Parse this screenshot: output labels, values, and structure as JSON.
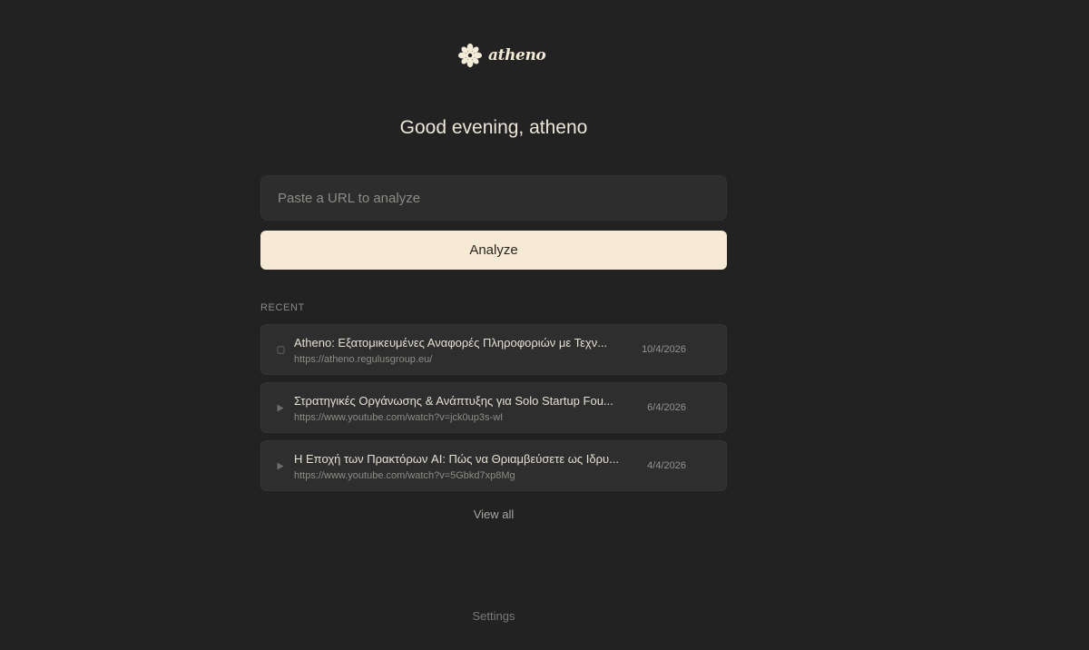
{
  "brand": {
    "name": "atheno",
    "icon": "flower-logo-icon"
  },
  "greeting": "Good evening, atheno",
  "url_input": {
    "placeholder": "Paste a URL to analyze",
    "value": ""
  },
  "analyze_button": {
    "label": "Analyze"
  },
  "recent": {
    "heading": "RECENT",
    "items": [
      {
        "icon": "document-icon",
        "title": "Atheno: Εξατομικευμένες Αναφορές Πληροφοριών με Τεχν...",
        "url": "https://atheno.regulusgroup.eu/",
        "date": "10/4/2026"
      },
      {
        "icon": "play-icon",
        "title": "Στρατηγικές Οργάνωσης & Ανάπτυξης για Solo Startup Fou...",
        "url": "https://www.youtube.com/watch?v=jck0up3s-wI",
        "date": "6/4/2026"
      },
      {
        "icon": "play-icon",
        "title": "Η Εποχή των Πρακτόρων AI: Πώς να Θριαμβεύσετε ως Ιδρυ...",
        "url": "https://www.youtube.com/watch?v=5Gbkd7xp8Mg",
        "date": "4/4/2026"
      }
    ]
  },
  "view_all_label": "View all",
  "settings_label": "Settings",
  "colors": {
    "background": "#222222",
    "card": "#2e2e2e",
    "input": "#2d2d2d",
    "accent_button": "#f6ead4",
    "text_primary": "#ece6d9",
    "text_muted": "#8c8a85"
  }
}
